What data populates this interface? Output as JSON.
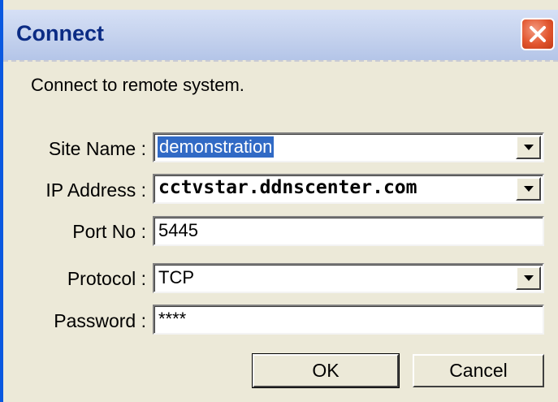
{
  "window": {
    "title": "Connect"
  },
  "dialog": {
    "prompt": "Connect to remote system."
  },
  "fields": {
    "site_name": {
      "label": "Site Name :",
      "value": "demonstration"
    },
    "ip_address": {
      "label": "IP Address :",
      "value": "cctvstar.ddnscenter.com"
    },
    "port_no": {
      "label": "Port No :",
      "value": "5445"
    },
    "protocol": {
      "label": "Protocol :",
      "value": "TCP"
    },
    "password": {
      "label": "Password :",
      "value": "****"
    }
  },
  "buttons": {
    "ok": "OK",
    "cancel": "Cancel"
  },
  "icons": {
    "close": "close-icon",
    "dropdown": "chevron-down-icon"
  },
  "colors": {
    "title_text": "#0b2b84",
    "selection": "#316ac5",
    "close_button": "#e2562f",
    "frame": "#0a58e0"
  }
}
